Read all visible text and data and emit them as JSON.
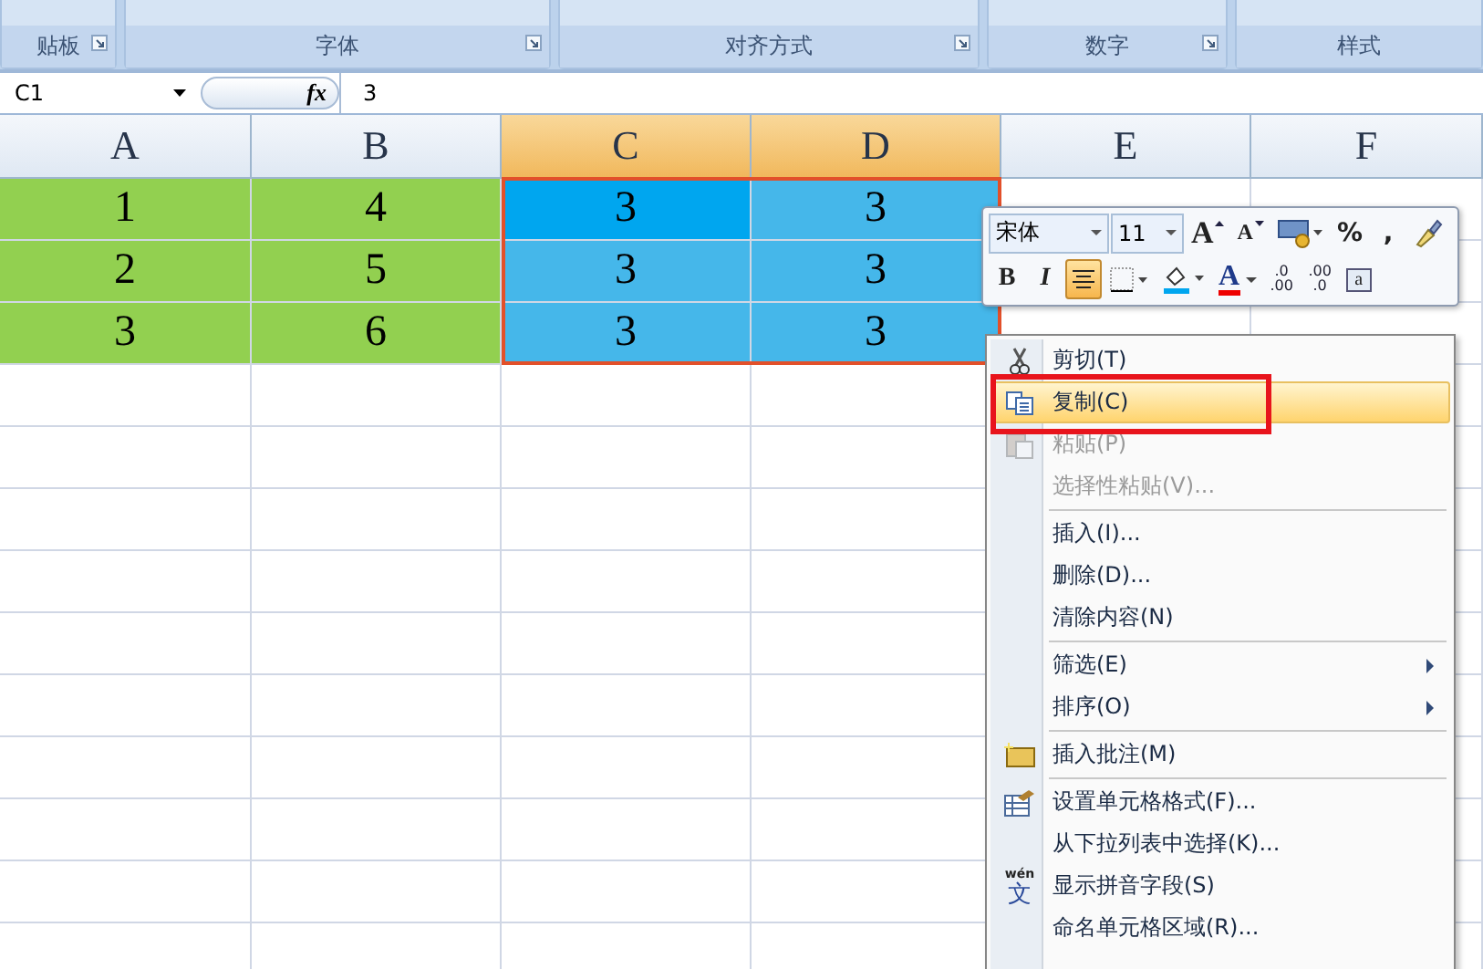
{
  "ribbon": {
    "groups": [
      {
        "label": "贴板"
      },
      {
        "label": "字体"
      },
      {
        "label": "对齐方式"
      },
      {
        "label": "数字"
      },
      {
        "label": "样式"
      }
    ]
  },
  "formula_bar": {
    "name_box": "C1",
    "fx": "fx",
    "value": "3"
  },
  "columns": [
    {
      "label": "A",
      "selected": false
    },
    {
      "label": "B",
      "selected": false
    },
    {
      "label": "C",
      "selected": true
    },
    {
      "label": "D",
      "selected": true
    },
    {
      "label": "E",
      "selected": false
    },
    {
      "label": "F",
      "selected": false
    }
  ],
  "rows": [
    {
      "cells": [
        {
          "value": "1",
          "color": "#92d050"
        },
        {
          "value": "4",
          "color": "#92d050"
        },
        {
          "value": "3",
          "color": "#00a6ef"
        },
        {
          "value": "3",
          "color": "#45b7ea"
        }
      ]
    },
    {
      "cells": [
        {
          "value": "2",
          "color": "#92d050"
        },
        {
          "value": "5",
          "color": "#92d050"
        },
        {
          "value": "3",
          "color": "#45b7ea"
        },
        {
          "value": "3",
          "color": "#45b7ea"
        }
      ]
    },
    {
      "cells": [
        {
          "value": "3",
          "color": "#92d050"
        },
        {
          "value": "6",
          "color": "#92d050"
        },
        {
          "value": "3",
          "color": "#45b7ea"
        },
        {
          "value": "3",
          "color": "#45b7ea"
        }
      ]
    }
  ],
  "mini_toolbar": {
    "font": "宋体",
    "size": "11",
    "row1": [
      {
        "kind": "grow",
        "label": "A",
        "selected": false
      },
      {
        "kind": "shrink",
        "label": "A",
        "selected": false
      },
      {
        "kind": "accounting",
        "selected": false
      },
      {
        "kind": "text",
        "label": "%",
        "selected": false
      },
      {
        "kind": "text",
        "label": ",",
        "selected": false
      },
      {
        "kind": "painter",
        "selected": false
      }
    ],
    "row2": [
      {
        "kind": "bold",
        "label": "B",
        "selected": false
      },
      {
        "kind": "italic",
        "label": "I",
        "selected": false
      },
      {
        "kind": "center",
        "selected": true
      },
      {
        "kind": "border",
        "selected": false
      },
      {
        "kind": "fill",
        "selected": false
      },
      {
        "kind": "fontcolor",
        "label": "A",
        "selected": false
      },
      {
        "kind": "incdec",
        "label": ".0",
        "label2": ".00",
        "selected": false
      },
      {
        "kind": "decdec",
        "label": ".00",
        "label2": ".0",
        "selected": false
      },
      {
        "kind": "merge",
        "label": "a",
        "selected": false
      }
    ]
  },
  "context_menu": [
    {
      "label": "剪切(T)",
      "kind": "scissors",
      "disabled": false,
      "selected": false,
      "submenu": false,
      "separator_before": false
    },
    {
      "label": "复制(C)",
      "kind": "copy",
      "disabled": false,
      "selected": true,
      "submenu": false,
      "separator_before": false
    },
    {
      "label": "粘贴(P)",
      "kind": "paste",
      "disabled": true,
      "selected": false,
      "submenu": false,
      "separator_before": false
    },
    {
      "label": "选择性粘贴(V)...",
      "kind": "plain",
      "disabled": true,
      "selected": false,
      "submenu": false,
      "separator_before": false
    },
    {
      "label": "插入(I)...",
      "kind": "plain",
      "disabled": false,
      "selected": false,
      "submenu": false,
      "separator_before": true
    },
    {
      "label": "删除(D)...",
      "kind": "plain",
      "disabled": false,
      "selected": false,
      "submenu": false,
      "separator_before": false
    },
    {
      "label": "清除内容(N)",
      "kind": "plain",
      "disabled": false,
      "selected": false,
      "submenu": false,
      "separator_before": false
    },
    {
      "label": "筛选(E)",
      "kind": "plain",
      "disabled": false,
      "selected": false,
      "submenu": true,
      "separator_before": true
    },
    {
      "label": "排序(O)",
      "kind": "plain",
      "disabled": false,
      "selected": false,
      "submenu": true,
      "separator_before": false
    },
    {
      "label": "插入批注(M)",
      "kind": "comment",
      "disabled": false,
      "selected": false,
      "submenu": false,
      "separator_before": true
    },
    {
      "label": "设置单元格格式(F)...",
      "kind": "format",
      "disabled": false,
      "selected": false,
      "submenu": false,
      "separator_before": true
    },
    {
      "label": "从下拉列表中选择(K)...",
      "kind": "plain",
      "disabled": false,
      "selected": false,
      "submenu": false,
      "separator_before": false
    },
    {
      "label": "显示拼音字段(S)",
      "kind": "phonetic",
      "icon_top": "wén",
      "icon_main": "文",
      "disabled": false,
      "selected": false,
      "submenu": false,
      "separator_before": false
    },
    {
      "label": "命名单元格区域(R)...",
      "kind": "plain",
      "disabled": false,
      "selected": false,
      "submenu": false,
      "separator_before": false
    }
  ]
}
